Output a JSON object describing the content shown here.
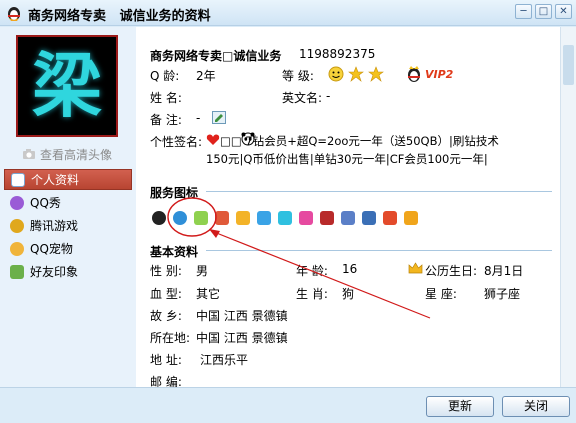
{
  "window": {
    "title": "商务网络专卖   诚信业务的资料",
    "controls": [
      "minimize",
      "maximize",
      "close"
    ]
  },
  "left_panel": {
    "avatar_char": "梁",
    "view_hd_label": "查看高清头像",
    "nav": [
      {
        "label": "个人资料",
        "icon": "profile-icon",
        "active": true
      },
      {
        "label": "QQ秀",
        "icon": "qqshow-icon",
        "active": false
      },
      {
        "label": "腾讯游戏",
        "icon": "game-icon",
        "active": false
      },
      {
        "label": "QQ宠物",
        "icon": "pet-icon",
        "active": false
      },
      {
        "label": "好友印象",
        "icon": "impression-icon",
        "active": false
      }
    ]
  },
  "profile": {
    "name_line": "商务网络专卖□诚信业务",
    "qq_number": "1198892375",
    "q_age_label": "Q  龄:",
    "q_age_value": "2年",
    "level_label": "等  级:",
    "vip_label": "VIP2",
    "name_label": "姓  名:",
    "name_value": "",
    "english_name_label": "英文名:",
    "english_name_value": "-",
    "remark_label": "备  注:",
    "remark_value": "-",
    "signature_label": "个性签名:",
    "signature_line1": "□□ 7钻会员+超Q=2oo元一年（送50QB）|刷钻技术",
    "signature_line2": "150元|Q币低价出售|单钻30元一年|CF会员100元一年|"
  },
  "services": {
    "title": "服务图标",
    "icons": [
      "penguin-icon",
      "qq-member-icon",
      "red-diamond-icon",
      "yellow-diamond-icon",
      "green-diamond-icon",
      "blue-diamond-icon",
      "purple-diamond-icon",
      "pink-diamond-icon",
      "super-qq-icon",
      "mobile-icon",
      "computer-icon",
      "house-icon",
      "book-icon"
    ]
  },
  "basic": {
    "title": "基本资料",
    "gender_label": "性  别:",
    "gender_value": "男",
    "age_label": "年  龄:",
    "age_value": "16",
    "birthday_label": "公历生日:",
    "birthday_value": "8月1日",
    "blood_label": "血  型:",
    "blood_value": "其它",
    "zodiac_label": "生  肖:",
    "zodiac_value": "狗",
    "constellation_label": "星      座:",
    "constellation_value": "狮子座",
    "hometown_label": "故  乡:",
    "hometown_value": "中国 江西 景德镇",
    "location_label": "所在地:",
    "location_value": "中国 江西 景德镇",
    "address_label": "地  址:",
    "address_value": "江西乐平",
    "postcode_label": "邮  编:",
    "postcode_value": ""
  },
  "buttons": {
    "refresh": "更新",
    "close": "关闭"
  },
  "colors": {
    "accent_red": "#c44b3a",
    "title_gradient_top": "#e9f4fc",
    "annotation_red": "#d11a1a"
  }
}
